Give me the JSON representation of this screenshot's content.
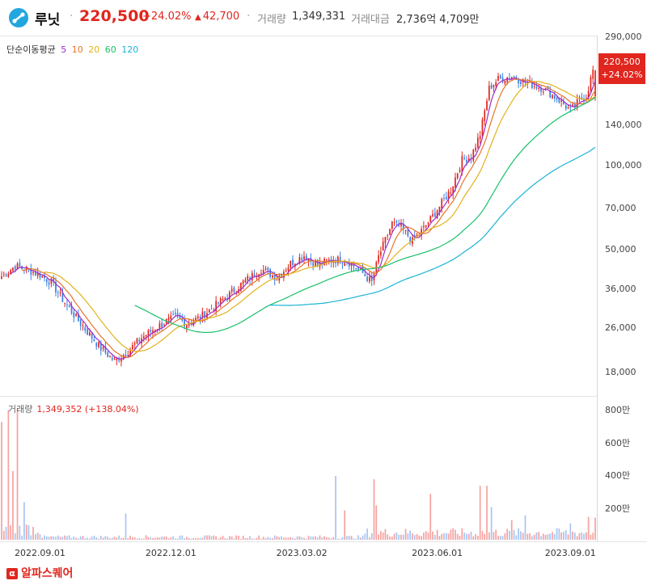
{
  "header": {
    "name": "루닛",
    "price": "220,500",
    "change_pct": "+24.02%",
    "change_abs": "42,700",
    "volume_label": "거래량",
    "volume_value": "1,349,331",
    "amount_label": "거래대금",
    "amount_value": "2,736억 4,709만",
    "colors": {
      "up": "#e0261e",
      "down": "#3c7fe0",
      "logo": "#22a6de"
    }
  },
  "legend": {
    "label": "단순이동평균",
    "items": [
      {
        "period": "5",
        "color": "#9b2cc8"
      },
      {
        "period": "10",
        "color": "#e8742a"
      },
      {
        "period": "20",
        "color": "#e2b21c"
      },
      {
        "period": "60",
        "color": "#19c06a"
      },
      {
        "period": "120",
        "color": "#1ab3d6"
      }
    ]
  },
  "price_box": {
    "price": "220,500",
    "pct": "+24.02%"
  },
  "volume_panel": {
    "label": "거래량",
    "value": "1,349,352 (+138.04%)"
  },
  "brand": {
    "mark": "α",
    "name": "알파스퀘어"
  },
  "chart_data": [
    {
      "type": "candlestick",
      "title": "",
      "y_scale": "log",
      "y_ticks": [
        "290,000",
        "140,000",
        "100,000",
        "70,000",
        "50,000",
        "36,000",
        "26,000",
        "18,000"
      ],
      "y_tick_values": [
        290000,
        140000,
        100000,
        70000,
        50000,
        36000,
        26000,
        18000
      ],
      "x_ticks": [
        "2022.09.01",
        "2022.12.01",
        "2023.03.02",
        "2023.06.01",
        "2023.09.01"
      ],
      "x_tick_index": [
        17,
        75,
        133,
        193,
        252
      ],
      "num_days": 264,
      "last_close": 220500,
      "close_anchors": [
        [
          0,
          40000
        ],
        [
          6,
          43500
        ],
        [
          12,
          42000
        ],
        [
          17,
          40500
        ],
        [
          22,
          38000
        ],
        [
          27,
          33000
        ],
        [
          35,
          27000
        ],
        [
          44,
          22000
        ],
        [
          50,
          19800
        ],
        [
          56,
          21500
        ],
        [
          62,
          24000
        ],
        [
          68,
          26000
        ],
        [
          73,
          27500
        ],
        [
          77,
          28500
        ],
        [
          82,
          27000
        ],
        [
          88,
          28500
        ],
        [
          95,
          31500
        ],
        [
          102,
          35000
        ],
        [
          107,
          38000
        ],
        [
          115,
          42500
        ],
        [
          122,
          39500
        ],
        [
          128,
          44500
        ],
        [
          134,
          47500
        ],
        [
          140,
          44000
        ],
        [
          147,
          46000
        ],
        [
          153,
          45500
        ],
        [
          160,
          41000
        ],
        [
          164,
          38000
        ],
        [
          167,
          47000
        ],
        [
          173,
          62000
        ],
        [
          177,
          60000
        ],
        [
          182,
          53500
        ],
        [
          187,
          59500
        ],
        [
          193,
          69500
        ],
        [
          199,
          82000
        ],
        [
          204,
          105000
        ],
        [
          208,
          108000
        ],
        [
          212,
          130000
        ],
        [
          216,
          190000
        ],
        [
          220,
          205000
        ],
        [
          226,
          210000
        ],
        [
          232,
          200000
        ],
        [
          240,
          190000
        ],
        [
          246,
          175000
        ],
        [
          252,
          158000
        ],
        [
          256,
          172000
        ],
        [
          259,
          178000
        ],
        [
          262,
          220500
        ]
      ],
      "ma_periods": [
        5,
        10,
        20,
        60,
        120
      ],
      "series": [
        {
          "name": "5",
          "color": "#9b2cc8"
        },
        {
          "name": "10",
          "color": "#e8742a"
        },
        {
          "name": "20",
          "color": "#e2b21c"
        },
        {
          "name": "60",
          "color": "#19c06a"
        },
        {
          "name": "120",
          "color": "#1ab3d6"
        }
      ]
    },
    {
      "type": "bar",
      "title": "",
      "y_ticks": [
        "800만",
        "600만",
        "400만",
        "200만"
      ],
      "y_tick_values": [
        8000000,
        6000000,
        4000000,
        2000000
      ],
      "ylim": [
        0,
        8000000
      ],
      "spikes": [
        [
          0,
          7200000
        ],
        [
          3,
          7900000
        ],
        [
          5,
          4200000
        ],
        [
          7,
          8000000
        ],
        [
          10,
          2300000
        ],
        [
          55,
          1600000
        ],
        [
          148,
          3900000
        ],
        [
          152,
          1800000
        ],
        [
          165,
          3700000
        ],
        [
          166,
          2100000
        ],
        [
          190,
          2800000
        ],
        [
          212,
          3300000
        ],
        [
          215,
          3300000
        ],
        [
          217,
          2000000
        ],
        [
          226,
          1200000
        ],
        [
          232,
          1500000
        ],
        [
          252,
          1000000
        ],
        [
          260,
          1400000
        ],
        [
          263,
          1350000
        ]
      ],
      "base_volume": 120000
    }
  ]
}
